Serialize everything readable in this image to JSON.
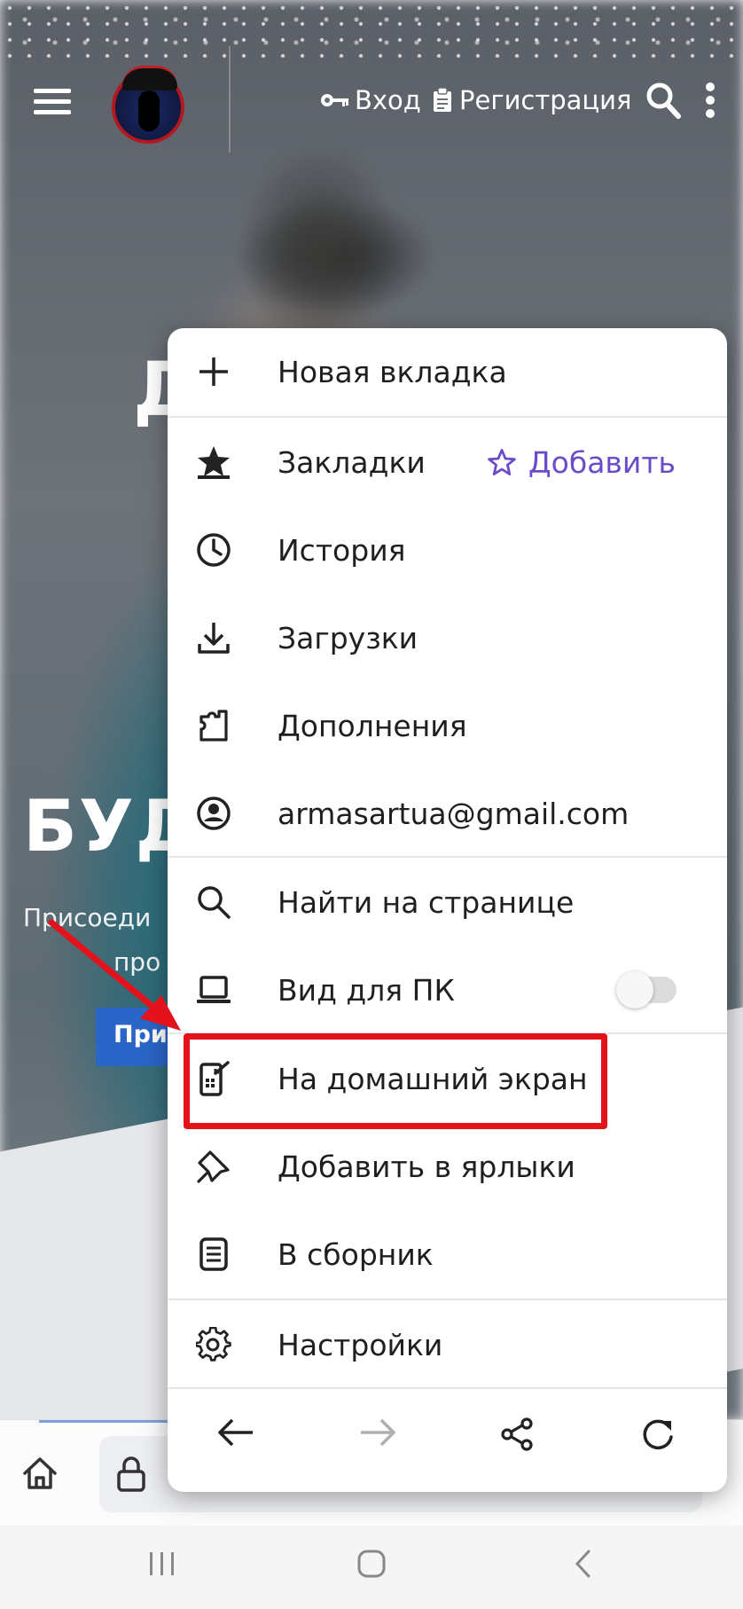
{
  "site": {
    "login_label": "Вход",
    "register_label": "Регистрация",
    "hero_letter": "Д",
    "hero_title": "БУД",
    "hero_subtitle_line1": "Присоеди",
    "hero_subtitle_line2": "про",
    "hero_button": "При"
  },
  "menu": {
    "new_tab": "Новая вкладка",
    "bookmarks": "Закладки",
    "bookmarks_add": "Добавить",
    "history": "История",
    "downloads": "Загрузки",
    "extensions": "Дополнения",
    "account": "armasartua@gmail.com",
    "find_in_page": "Найти на странице",
    "desktop_view": "Вид для ПК",
    "desktop_view_enabled": false,
    "add_to_home": "На домашний экран",
    "add_to_shortcuts": "Добавить в ярлыки",
    "to_collection": "В сборник",
    "settings": "Настройки"
  },
  "colors": {
    "accent": "#6a4cc8",
    "highlight": "#e3121b",
    "site_button": "#2a66c8"
  },
  "icons": {
    "new_tab": "plus-icon",
    "bookmarks": "star-bookmark-icon",
    "bookmarks_add": "star-outline-icon",
    "history": "clock-icon",
    "downloads": "download-icon",
    "extensions": "puzzle-icon",
    "account": "account-circle-icon",
    "find_in_page": "search-icon",
    "desktop_view": "laptop-icon",
    "add_to_home": "phone-add-icon",
    "add_to_shortcuts": "pin-icon",
    "to_collection": "document-icon",
    "settings": "gear-icon"
  }
}
